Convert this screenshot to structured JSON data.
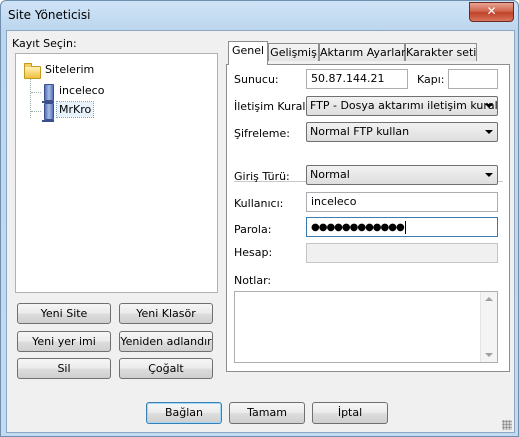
{
  "window": {
    "title": "Site Yöneticisi",
    "close_label": "✕"
  },
  "left": {
    "label": "Kayıt Seçin:",
    "tree": {
      "root": "Sitelerim",
      "items": [
        "inceleco",
        "MrKro"
      ]
    },
    "buttons": {
      "new_site": "Yeni Site",
      "new_folder": "Yeni Klasör",
      "new_bookmark": "Yeni yer imi",
      "rename": "Yeniden adlandır",
      "delete": "Sil",
      "duplicate": "Çoğalt"
    }
  },
  "tabs": [
    "Genel",
    "Gelişmiş",
    "Aktarım Ayarları",
    "Karakter seti"
  ],
  "general": {
    "host_label": "Sunucu:",
    "host_value": "50.87.144.21",
    "port_label": "Kapı:",
    "port_value": "",
    "protocol_label": "İletişim Kuralı:",
    "protocol_value": "FTP - Dosya aktarımı iletişim kuralı",
    "encryption_label": "Şifreleme:",
    "encryption_value": "Normal FTP kullan",
    "logon_label": "Giriş Türü:",
    "logon_value": "Normal",
    "user_label": "Kullanıcı:",
    "user_value": "inceleco",
    "password_label": "Parola:",
    "password_value": "●●●●●●●●●●●●",
    "account_label": "Hesap:",
    "account_value": "",
    "notes_label": "Notlar:",
    "notes_value": ""
  },
  "footer": {
    "connect": "Bağlan",
    "ok": "Tamam",
    "cancel": "İptal"
  },
  "colors": {
    "title_bar": "#c3dbf1",
    "close_button": "#c0412a",
    "selection": "#e8f2fb"
  }
}
